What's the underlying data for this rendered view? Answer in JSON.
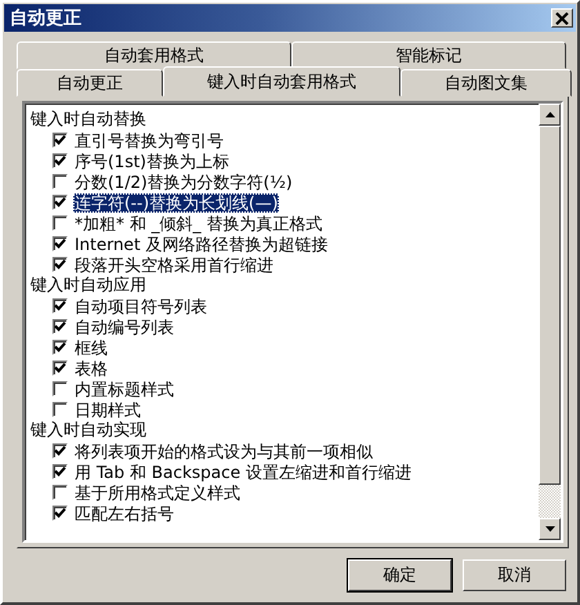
{
  "window": {
    "title": "自动更正"
  },
  "tab_rows": [
    [
      {
        "label": "自动套用格式",
        "selected": false
      },
      {
        "label": "智能标记",
        "selected": false
      }
    ],
    [
      {
        "label": "自动更正",
        "selected": false
      },
      {
        "label": "键入时自动套用格式",
        "selected": true
      },
      {
        "label": "自动图文集",
        "selected": false
      }
    ]
  ],
  "groups": [
    {
      "heading": "键入时自动替换",
      "items": [
        {
          "label": "直引号替换为弯引号",
          "checked": true,
          "selected": false
        },
        {
          "label": "序号(1st)替换为上标",
          "checked": true,
          "selected": false
        },
        {
          "label": "分数(1/2)替换为分数字符(½)",
          "checked": false,
          "selected": false
        },
        {
          "label": "连字符(--)替换为长划线(—)",
          "checked": true,
          "selected": true
        },
        {
          "label": "*加粗* 和 _倾斜_ 替换为真正格式",
          "checked": false,
          "selected": false
        },
        {
          "label": "Internet 及网络路径替换为超链接",
          "checked": true,
          "selected": false
        },
        {
          "label": "段落开头空格采用首行缩进",
          "checked": true,
          "selected": false
        }
      ]
    },
    {
      "heading": "键入时自动应用",
      "items": [
        {
          "label": "自动项目符号列表",
          "checked": true,
          "selected": false
        },
        {
          "label": "自动编号列表",
          "checked": true,
          "selected": false
        },
        {
          "label": "框线",
          "checked": true,
          "selected": false
        },
        {
          "label": "表格",
          "checked": true,
          "selected": false
        },
        {
          "label": "内置标题样式",
          "checked": false,
          "selected": false
        },
        {
          "label": "日期样式",
          "checked": false,
          "selected": false
        }
      ]
    },
    {
      "heading": "键入时自动实现",
      "items": [
        {
          "label": "将列表项开始的格式设为与其前一项相似",
          "checked": true,
          "selected": false
        },
        {
          "label": "用 Tab 和 Backspace 设置左缩进和首行缩进",
          "checked": true,
          "selected": false
        },
        {
          "label": "基于所用格式定义样式",
          "checked": false,
          "selected": false
        },
        {
          "label": "匹配左右括号",
          "checked": true,
          "selected": false
        }
      ]
    }
  ],
  "buttons": [
    "确定",
    "取消"
  ]
}
